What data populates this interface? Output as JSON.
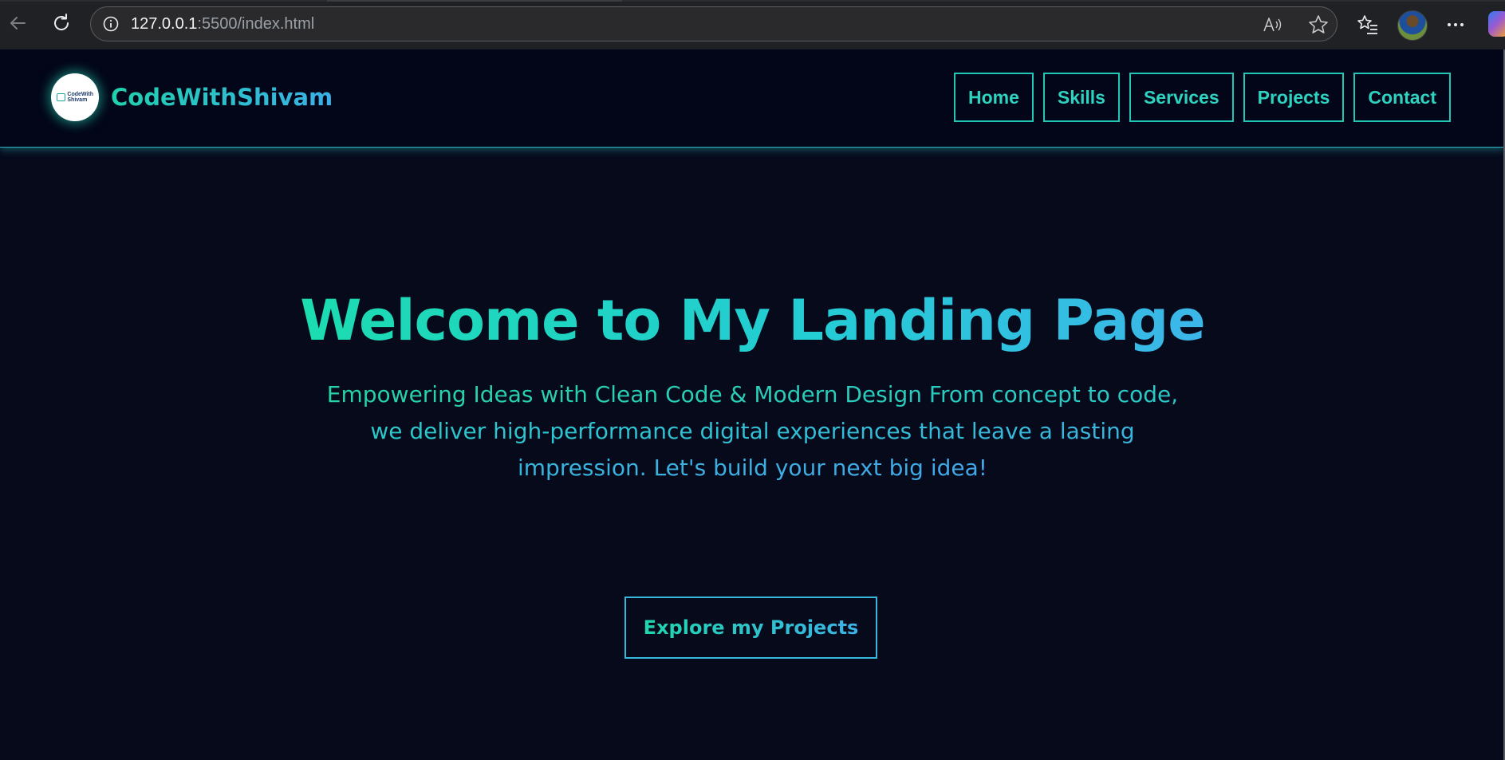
{
  "browser": {
    "url_host": "127.0.0.1",
    "url_rest": ":5500/index.html",
    "icons": {
      "back": "back-arrow-icon",
      "reload": "reload-icon",
      "site_info": "info-icon",
      "read_aloud": "read-aloud-icon",
      "favorite": "star-icon",
      "favorites": "favorites-icon",
      "more": "more-icon"
    }
  },
  "site": {
    "logo_text_line1": "CodeWith",
    "logo_text_line2": "Shivam",
    "brand": "CodeWithShivam",
    "nav": [
      {
        "label": "Home"
      },
      {
        "label": "Skills"
      },
      {
        "label": "Services"
      },
      {
        "label": "Projects"
      },
      {
        "label": "Contact"
      }
    ]
  },
  "hero": {
    "title": "Welcome to My Landing Page",
    "subtitle": "Empowering Ideas with Clean Code & Modern Design From concept to code, we deliver high-performance digital experiences that leave a lasting impression. Let's build your next big idea!",
    "cta": "Explore my Projects"
  },
  "colors": {
    "page_bg": "#060a1b",
    "header_bg": "#020618",
    "accent_green": "#1fd1ad",
    "accent_blue": "#3ab0e8"
  }
}
